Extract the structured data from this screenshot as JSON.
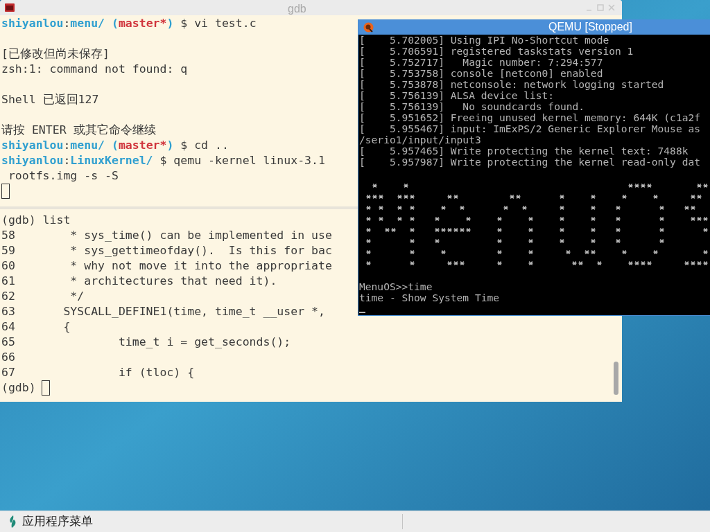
{
  "gdb_window": {
    "title": "gdb",
    "top_pane": {
      "lines": [
        {
          "kind": "text",
          "spans": [
            {
              "text": "shiyanlou",
              "kind": "prompt"
            },
            {
              "text": ":",
              "kind": "plain"
            },
            {
              "text": "menu/ (",
              "kind": "prompt"
            },
            {
              "text": "master*",
              "kind": "branch"
            },
            {
              "text": ")",
              "kind": "prompt"
            },
            {
              "text": " $ vi test.c",
              "kind": "plain"
            }
          ]
        },
        {
          "kind": "blank"
        },
        {
          "kind": "text",
          "spans": [
            {
              "text": "[已修改但尚未保存]",
              "kind": "plain"
            }
          ]
        },
        {
          "kind": "text",
          "spans": [
            {
              "text": "zsh:1: command not found: q",
              "kind": "plain"
            }
          ]
        },
        {
          "kind": "blank"
        },
        {
          "kind": "text",
          "spans": [
            {
              "text": "Shell 已返回127",
              "kind": "plain"
            }
          ]
        },
        {
          "kind": "blank"
        },
        {
          "kind": "text",
          "spans": [
            {
              "text": "请按 ENTER 或其它命令继续",
              "kind": "plain"
            }
          ]
        },
        {
          "kind": "text",
          "spans": [
            {
              "text": "shiyanlou",
              "kind": "prompt"
            },
            {
              "text": ":",
              "kind": "plain"
            },
            {
              "text": "menu/ (",
              "kind": "prompt"
            },
            {
              "text": "master*",
              "kind": "branch"
            },
            {
              "text": ")",
              "kind": "prompt"
            },
            {
              "text": " $ cd ..",
              "kind": "plain"
            }
          ]
        },
        {
          "kind": "text",
          "spans": [
            {
              "text": "shiyanlou",
              "kind": "prompt"
            },
            {
              "text": ":",
              "kind": "plain"
            },
            {
              "text": "LinuxKernel/",
              "kind": "prompt"
            },
            {
              "text": " $ qemu -kernel linux-3.1",
              "kind": "plain"
            }
          ]
        },
        {
          "kind": "text",
          "spans": [
            {
              "text": " rootfs.img -s -S",
              "kind": "plain"
            }
          ]
        },
        {
          "kind": "cursor"
        }
      ]
    },
    "bottom_pane": {
      "lines": [
        {
          "text": "(gdb) list",
          "cursor": false
        },
        {
          "text": "58        * sys_time() can be implemented in use",
          "cursor": false
        },
        {
          "text": "59        * sys_gettimeofday().  Is this for bac",
          "cursor": false
        },
        {
          "text": "60        * why not move it into the appropriate",
          "cursor": false
        },
        {
          "text": "61        * architectures that need it).",
          "cursor": false
        },
        {
          "text": "62        */",
          "cursor": false
        },
        {
          "text": "63       SYSCALL_DEFINE1(time, time_t __user *,",
          "cursor": false
        },
        {
          "text": "64       {",
          "cursor": false
        },
        {
          "text": "65               time_t i = get_seconds();",
          "cursor": false
        },
        {
          "text": "66",
          "cursor": false
        },
        {
          "text": "67               if (tloc) {",
          "cursor": false
        },
        {
          "text": "(gdb)",
          "cursor": true
        }
      ]
    }
  },
  "qemu_window": {
    "title": "QEMU [Stopped]",
    "lines": [
      "[    5.702005] Using IPI No-Shortcut mode",
      "[    5.706591] registered taskstats version 1",
      "[    5.752717]   Magic number: 7:294:577",
      "[    5.753758] console [netcon0] enabled",
      "[    5.753878] netconsole: network logging started",
      "[    5.756139] ALSA device list:",
      "[    5.756139]   No soundcards found.",
      "[    5.951652] Freeing unused kernel memory: 644K (c1a2f",
      "[    5.955467] input: ImExPS/2 Generic Explorer Mouse as",
      "/serio1/input/input3",
      "[    5.957465] Write protecting the kernel text: 7488k",
      "[    5.957987] Write protecting the kernel read-only dat"
    ],
    "prompt_lines": [
      "MenuOS>>time",
      "time - Show System Time"
    ],
    "cursor": true
  },
  "taskbar": {
    "menu_label": "应用程序菜单"
  }
}
